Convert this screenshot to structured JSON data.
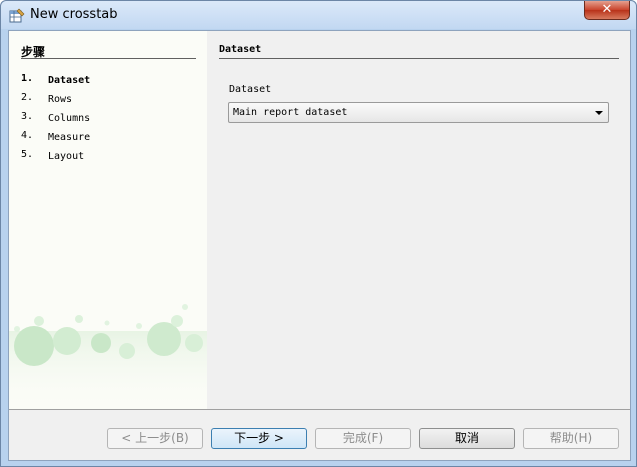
{
  "window": {
    "title": "New crosstab",
    "close_glyph": "✕"
  },
  "icons": {
    "app": "crosstab-wizard-icon",
    "close": "close-icon",
    "dropdown": "chevron-down-icon"
  },
  "sidebar": {
    "title": "步骤",
    "steps": [
      {
        "num": "1.",
        "label": "Dataset",
        "active": true
      },
      {
        "num": "2.",
        "label": "Rows",
        "active": false
      },
      {
        "num": "3.",
        "label": "Columns",
        "active": false
      },
      {
        "num": "4.",
        "label": "Measure",
        "active": false
      },
      {
        "num": "5.",
        "label": "Layout",
        "active": false
      }
    ]
  },
  "main": {
    "section_title": "Dataset",
    "dataset_field": {
      "label": "Dataset",
      "value": "Main report dataset"
    }
  },
  "buttons": {
    "back": {
      "label": "< 上一步(B)",
      "enabled": false
    },
    "next": {
      "label": "下一步 >",
      "enabled": true
    },
    "finish": {
      "label": "完成(F)",
      "enabled": false
    },
    "cancel": {
      "label": "取消",
      "enabled": true
    },
    "help": {
      "label": "帮助(H)",
      "enabled": false
    }
  },
  "colors": {
    "titlebar": "#c2d8f2",
    "sidebar_bg": "#fbfcf7",
    "panel_bg": "#f0f0f0",
    "close_red": "#c9432b",
    "bubble_green": "#c7e8c8"
  }
}
